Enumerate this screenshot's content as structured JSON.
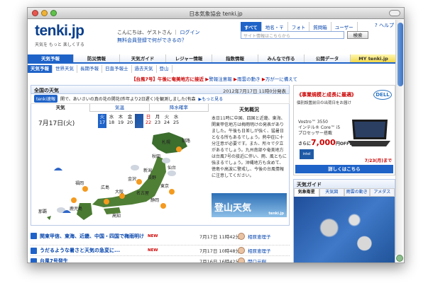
{
  "window": {
    "title": "日本気象協会 tenki.jp"
  },
  "header": {
    "logo": "tenki.jp",
    "tagline": "天気を もっと 楽しくする",
    "greeting": "こんにちは、ゲストさん",
    "login": "ログイン",
    "register": "無料会員登録で何ができるの？",
    "search_tabs": [
      "すべて",
      "地名・〒",
      "フォト",
      "質問箱",
      "ユーザー"
    ],
    "search_placeholder": "サイト情報はこちらから",
    "search_button": "検索",
    "help": "ヘルプ"
  },
  "nav": {
    "items": [
      "天気予報",
      "防災情報",
      "天気ガイド",
      "レジャー情報",
      "指数情報",
      "みんなで作る",
      "公開データ",
      "MY tenki.jp"
    ]
  },
  "subnav": {
    "items": [
      "天気予報",
      "世界天気",
      "長期予報",
      "日直予報士",
      "過去天気",
      "登山"
    ]
  },
  "alert": {
    "label": "【台風7号】午後に奄美地方に接近",
    "links": [
      "警報注意報",
      "雨雲の動き",
      "万が一に備えて"
    ]
  },
  "weather": {
    "title": "全国の天気",
    "datetime": "2012年7月17日 11時0分発表",
    "news_badge": "tenki速報",
    "news_text": "関で、あいさいの真の花の開花(昨年より2日遅く)を観測しました(有森",
    "news_more": "もっと見る",
    "tabs": [
      "天気",
      "気温",
      "降水確率"
    ],
    "date": "7月17日(火)",
    "days": [
      {
        "d": "火",
        "n": "17"
      },
      {
        "d": "水",
        "n": "18"
      },
      {
        "d": "木",
        "n": "19"
      },
      {
        "d": "金",
        "n": "20"
      },
      {
        "d": "土",
        "n": "21"
      },
      {
        "d": "日",
        "n": "22"
      },
      {
        "d": "月",
        "n": "23"
      },
      {
        "d": "火",
        "n": "24"
      },
      {
        "d": "水",
        "n": "25"
      }
    ],
    "cities": [
      "札幌",
      "釧路",
      "秋田",
      "仙台",
      "新潟",
      "金沢",
      "東京",
      "名古屋",
      "大阪",
      "広島",
      "福岡",
      "鹿児島",
      "那覇",
      "高知",
      "長野",
      "静岡"
    ],
    "side_title": "天気概況",
    "side_text": "本日11時に中国、四国と近畿、東海、関東甲信地方は梅雨明けの発表がありました。午後も日差しが強く、猛暑日となる所もあるでしょう。熱中症に十分注意が必要です。また、所々で夕立があるでしょう。九州南部や奄美地方は台風7号の接近に伴い、雨、風ともに強まるでしょう。沖縄地方も含めて、徳島や高波に警戒し、今後の台風情報に注意してください。",
    "banner": "登山天気",
    "banner_brand": "tenki.jp"
  },
  "articles": [
    {
      "title": "関東甲信、東海、近畿、中国・四国で梅雨明け",
      "new": "NEW",
      "time": "7月17日 11時42分",
      "author": "相原恵理子"
    },
    {
      "title": "うだるような暑さと天気の急変に...",
      "new": "NEW",
      "time": "7月17日 10時48分",
      "author": "相原恵理子"
    },
    {
      "title": "台風7号発生",
      "new": "",
      "time": "7月16日 16時42分",
      "author": "関口元樹"
    }
  ],
  "ad": {
    "headline": "《事業規模と成長に最適》",
    "sub": "個別設置前日の出荷日をお届け",
    "brand": "DELL",
    "model": "Vostro™ 3550",
    "cpu": "インテル® Core™ i5",
    "cpu2": "プロセッサー搭載",
    "price_prefix": "さらに",
    "price": "7,000",
    "price_suffix": "円OFF!",
    "intel": "intel",
    "date": "7/23(月)まで",
    "footer": "詳しくはこちら"
  },
  "guide": {
    "title": "天気ガイド",
    "tabs": [
      "気象衛星",
      "天気図",
      "雨雲の動き",
      "アメダス"
    ]
  }
}
